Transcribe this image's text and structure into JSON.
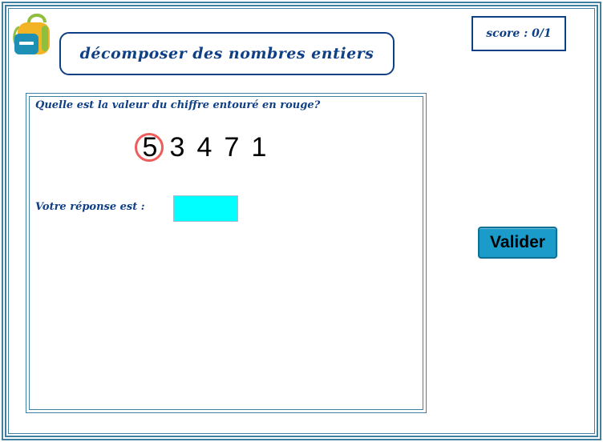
{
  "header": {
    "title": "décomposer des nombres entiers",
    "score": "score : 0/1"
  },
  "exercise": {
    "question": "Quelle est la valeur du chiffre entouré en rouge?",
    "digits": [
      "5",
      "3",
      "4",
      "7",
      "1"
    ],
    "circled_digit_index": 0,
    "answer_label": "Votre réponse est :",
    "answer_value": ""
  },
  "actions": {
    "submit_label": "Valider"
  },
  "colors": {
    "frame": "#3f7f9f",
    "title_text": "#0f3f85",
    "circle": "#ee5c5c",
    "answer_field": "#00ffff",
    "button": "#1a9bc9"
  },
  "icons": {
    "logo": "backpack-icon"
  }
}
